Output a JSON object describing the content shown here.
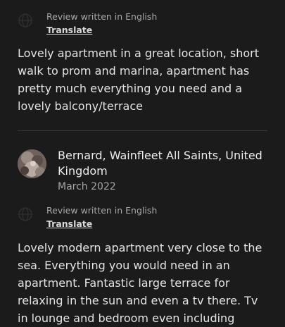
{
  "reviews": [
    {
      "language_note": "Review written in English",
      "translate_label": "Translate",
      "text": "Lovely apartment in a great location, short walk to prom and marina, apartment has pretty much everything you need and a lovely balcony/terrace"
    },
    {
      "reviewer_name": "Bernard, Wainfleet All Saints, United Kingdom",
      "date": "March 2022",
      "language_note": "Review written in English",
      "translate_label": "Translate",
      "text": "Lovely modern apartment very close to the sea. Everything you would need in an apartment. Fantastic large terrace for relaxing in the sun and even a tv there. Tv in lounge and bedroom even including"
    }
  ],
  "icons": {
    "translate": "globe-icon",
    "avatar": "reviewer-avatar"
  },
  "colors": {
    "background": "#1b1b1b",
    "text": "#e4e4e4",
    "muted": "#a8a8a8",
    "divider": "#3a3a3a"
  }
}
